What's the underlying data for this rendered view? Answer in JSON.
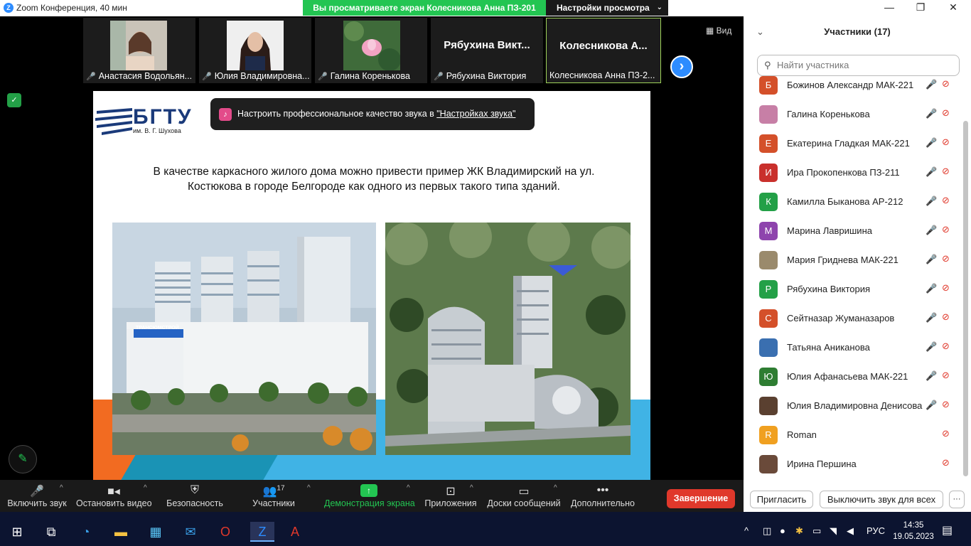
{
  "window": {
    "title": "Zoom Конференция, 40 мин",
    "logo": "Z",
    "minimize": "—",
    "maximize": "❐",
    "close": "✕"
  },
  "banner": {
    "viewing": "Вы просматриваете экран Колесникова Анна ПЗ-201",
    "settings": "Настройки просмотра"
  },
  "gallery": {
    "tiles": [
      {
        "name": "Анастасия Водольян...",
        "type": "photo"
      },
      {
        "name": "Юлия Владимировна...",
        "type": "photo"
      },
      {
        "name": "Галина Коренькова",
        "type": "photo"
      },
      {
        "name": "Рябухина Виктория",
        "big": "Рябухина Викт..."
      },
      {
        "name": "Колесникова Анна ПЗ-2...",
        "big": "Колесникова А..."
      }
    ],
    "view_label": "Вид"
  },
  "toast": {
    "text": "Настроить профессиональное качество звука в ",
    "link": "\"Настройках звука\""
  },
  "slide": {
    "logo": "БГТУ",
    "logo_sub": "им. В. Г. Шухова",
    "text": "В качестве каркасного жилого дома можно привести пример ЖК Владимирский на ул. Костюкова в городе Белгороде как одного из первых такого типа зданий.",
    "sign": "ТРАНСЮМСТРОЙ"
  },
  "participants": {
    "title": "Участники (17)",
    "search_placeholder": "Найти участника",
    "list": [
      {
        "name": "Божинов Александр МАК-221",
        "initial": "Б",
        "color": "#d4502a",
        "mic_muted": true
      },
      {
        "name": "Галина Коренькова",
        "initial": "",
        "color": "#c77fa6",
        "mic_muted": true
      },
      {
        "name": "Екатерина Гладкая МАК-221",
        "initial": "Е",
        "color": "#d4502a",
        "mic_muted": true
      },
      {
        "name": "Ира Прокопенкова ПЗ-211",
        "initial": "И",
        "color": "#c9302c",
        "mic_muted": true
      },
      {
        "name": "Камилла Быканова АР-212",
        "initial": "К",
        "color": "#23a047",
        "mic_muted": true
      },
      {
        "name": "Марина Лавришина",
        "initial": "М",
        "color": "#8e44ad",
        "mic_muted": true
      },
      {
        "name": "Мария Гриднева МАК-221",
        "initial": "",
        "color": "#9a8a6c",
        "mic_muted": true
      },
      {
        "name": "Рябухина Виктория",
        "initial": "Р",
        "color": "#23a047",
        "mic_muted": true
      },
      {
        "name": "Сейтназар Жуманазаров",
        "initial": "С",
        "color": "#d4502a",
        "mic_muted": true
      },
      {
        "name": "Татьяна Аниканова",
        "initial": "",
        "color": "#3a6fb0",
        "mic_muted": true
      },
      {
        "name": "Юлия Афанасьева МАК-221",
        "initial": "Ю",
        "color": "#2e7d32",
        "mic_muted": true
      },
      {
        "name": "Юлия Владимировна Денисова",
        "initial": "",
        "color": "#5a4030",
        "mic_muted": true
      },
      {
        "name": "Roman",
        "initial": "R",
        "color": "#f0a020",
        "mic_muted": false
      },
      {
        "name": "Ирина Першина",
        "initial": "",
        "color": "#6a4a3a",
        "mic_muted": false
      }
    ],
    "invite": "Пригласить",
    "mute_all": "Выключить звук для всех",
    "more": "···"
  },
  "toolbar": {
    "mic": "Включить звук",
    "video": "Остановить видео",
    "security": "Безопасность",
    "participants": "Участники",
    "participants_count": "17",
    "share": "Демонстрация экрана",
    "apps": "Приложения",
    "whiteboards": "Доски сообщений",
    "more": "Дополнительно",
    "end": "Завершение"
  },
  "taskbar": {
    "lang": "РУС",
    "time": "14:35",
    "date": "19.05.2023"
  },
  "colors": {
    "zoom_blue": "#2d8cff",
    "share_green": "#23c552",
    "end_red": "#e0382b",
    "slide_orange": "#f26b21",
    "slide_blue": "#40b3e5"
  }
}
